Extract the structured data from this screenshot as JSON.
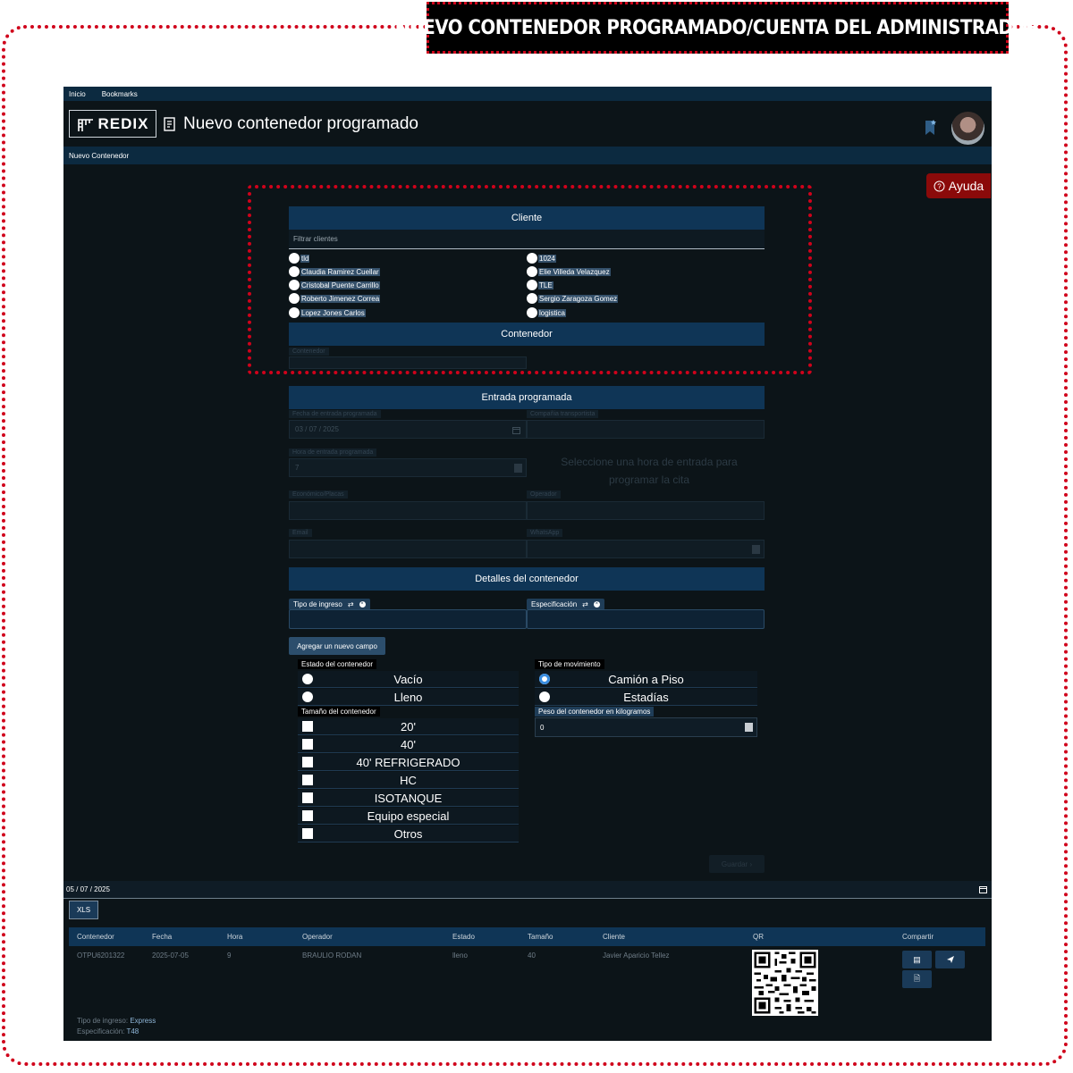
{
  "banner": "NUEVO CONTENEDOR PROGRAMADO/CUENTA DEL ADMINISTRADOR",
  "topmenu": {
    "inicio": "Inicio",
    "bookmarks": "Bookmarks"
  },
  "logo_text": "REDIX",
  "page_title": "Nuevo contenedor programado",
  "breadcrumb": "Nuevo Contenedor",
  "help_label": "Ayuda",
  "cliente": {
    "header": "Cliente",
    "filter_placeholder": "Filtrar clientes",
    "left": [
      "tld",
      "Claudia Ramirez Cuellar",
      "Cristobal Puente Carrillo",
      "Roberto Jimenez Correa",
      "Lopez Jones Carlos"
    ],
    "right": [
      "1024",
      "Elie Villeda Velazquez",
      "TLE",
      "Sergio Zaragoza Gomez",
      "logistica"
    ]
  },
  "contenedor": {
    "header": "Contenedor",
    "label": "Contenedor"
  },
  "entrada": {
    "header": "Entrada programada",
    "fecha_label": "Fecha de entrada programada",
    "fecha_value": "03 / 07 / 2025",
    "compania_label": "Compañia transportista",
    "hora_label": "Hora de entrada programada",
    "hora_value": "7",
    "hora_msg": "Seleccione una hora de entrada para programar la cita",
    "economico_label": "Económico/Placas",
    "operador_label": "Operador",
    "email_label": "Email",
    "whatsapp_label": "WhatsApp"
  },
  "detalles": {
    "header": "Detalles del contenedor",
    "tipo_ingreso_label": "Tipo de ingreso",
    "especificacion_label": "Especificación",
    "add_field": "Agregar un nuevo campo",
    "estado_label": "Estado del contenedor",
    "estado_options": [
      "Vacío",
      "Lleno"
    ],
    "tamano_label": "Tamaño del contenedor",
    "tamano_options": [
      "20'",
      "40'",
      "40' REFRIGERADO",
      "HC",
      "ISOTANQUE",
      "Equipo especial",
      "Otros"
    ],
    "movimiento_label": "Tipo de movimiento",
    "movimiento_options": [
      "Camión a Piso",
      "Estadías"
    ],
    "movimiento_selected": "Camión a Piso",
    "peso_label": "Peso del contenedor en kilogramos",
    "peso_value": "0",
    "guardar": "Guardar"
  },
  "listado": {
    "date": "05 / 07 / 2025",
    "xls": "XLS",
    "columns": [
      "Contenedor",
      "Fecha",
      "Hora",
      "Operador",
      "Estado",
      "Tamaño",
      "Cliente",
      "QR",
      "Compartir"
    ],
    "rows": [
      [
        "OTPU6201322",
        "2025-07-05",
        "9",
        "BRAULIO RODAN",
        "lleno",
        "40",
        "Javier Aparicio Tellez"
      ]
    ],
    "tipo_ingreso_label": "Tipo de ingreso:",
    "tipo_ingreso_value": "Express",
    "especificacion_label": "Especificación:",
    "especificacion_value": "T48"
  }
}
